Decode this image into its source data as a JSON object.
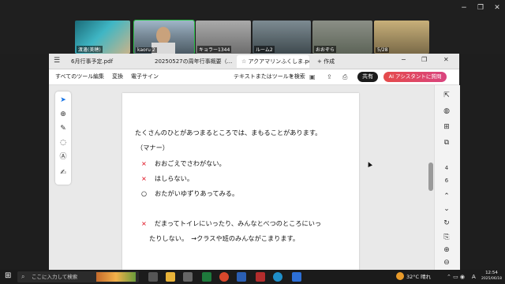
{
  "meeting": {
    "participants": [
      {
        "name": "渡邊(美穂)"
      },
      {
        "name": "kaoru 2"
      },
      {
        "name": "キョラー1344"
      },
      {
        "name": "ルーム2"
      },
      {
        "name": "おおぞら"
      },
      {
        "name": "5/28"
      }
    ],
    "window_controls": {
      "minimize": "−",
      "restore": "❐",
      "close": "✕"
    }
  },
  "browser": {
    "tabs": [
      {
        "label": "6月行事予定.pdf"
      },
      {
        "label": "20250527の周年行事概要（..."
      },
      {
        "label": "アクアマリンふくしま.pdf"
      }
    ],
    "new_tab_label": "+ 作成",
    "window_controls": {
      "minimize": "−",
      "restore": "❐",
      "close": "✕"
    }
  },
  "menubar": {
    "items": [
      "すべてのツール",
      "編集",
      "変換",
      "電子サイン"
    ],
    "search_label": "テキストまたはツールを検索",
    "share_label": "共有",
    "ai_label": "AI アシスタントに質問"
  },
  "document": {
    "lines": [
      {
        "mark": "",
        "text": "たくさんのひとがあつまるところでは、まもることがあります。"
      },
      {
        "mark": "",
        "text": "（マナー）"
      },
      {
        "mark": "×",
        "text": "おおごえでさわがない。"
      },
      {
        "mark": "×",
        "text": "はしらない。"
      },
      {
        "mark": "○",
        "text": "おたがいゆずりあってみる。"
      },
      {
        "mark": "×",
        "text": "だまってトイレにいったり、みんなとべつのところにいっ"
      },
      {
        "mark": "",
        "text": "たりしない。　→クラスや班のみんながこまります。"
      }
    ]
  },
  "rightpane": {
    "page_current": "4",
    "page_total": "6"
  },
  "taskbar": {
    "search_placeholder": "ここに入力して検索",
    "weather": "32°C  晴れ",
    "ime": "A",
    "time": "12:54",
    "date": "2025/06/18"
  },
  "colors": {
    "accent_red": "#d01c1c",
    "ai_gradient": "#e0447a",
    "share_bg": "#1b1b1b"
  }
}
